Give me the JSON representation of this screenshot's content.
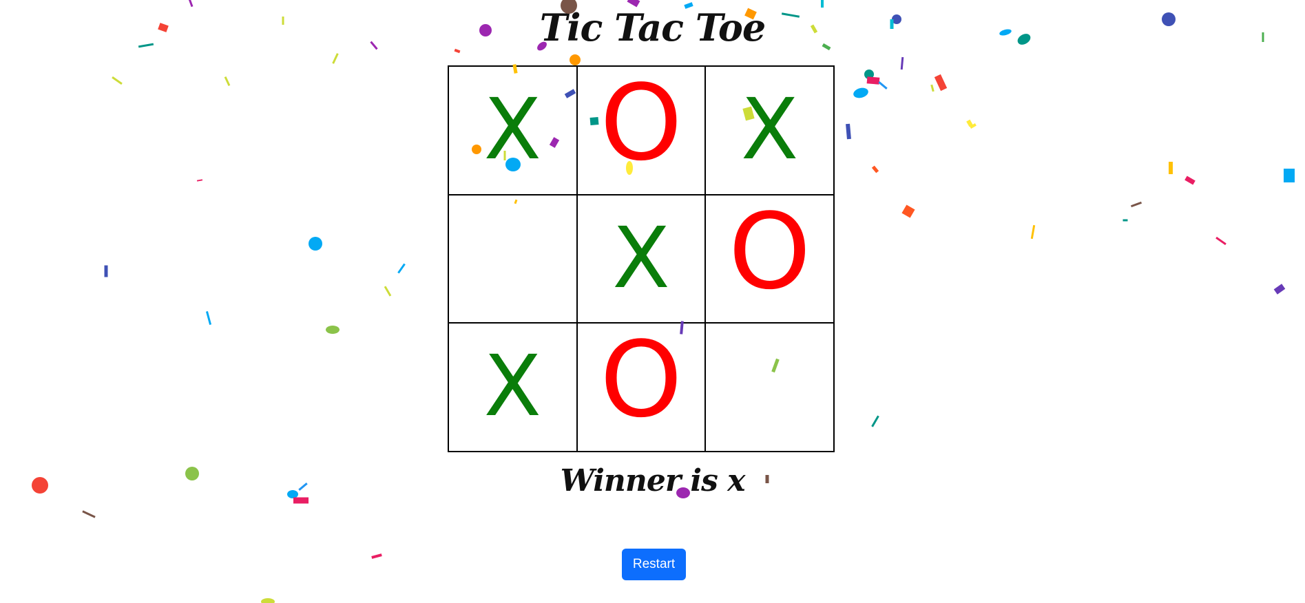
{
  "title": "Tic Tac Toe",
  "board": {
    "cells": [
      "X",
      "O",
      "X",
      "",
      "X",
      "O",
      "X",
      "O",
      ""
    ]
  },
  "status": {
    "winner_text": "Winner is x"
  },
  "controls": {
    "restart_label": "Restart"
  },
  "colors": {
    "x_mark": "#0a7d0a",
    "o_mark": "#ff0000",
    "restart_button": "#0d6efd",
    "confetti": [
      "#f44336",
      "#e91e63",
      "#9c27b0",
      "#673ab7",
      "#3f51b5",
      "#2196f3",
      "#03a9f4",
      "#00bcd4",
      "#009688",
      "#4caf50",
      "#8bc34a",
      "#cddc39",
      "#ffeb3b",
      "#ffc107",
      "#ff9800",
      "#ff5722",
      "#795548"
    ]
  }
}
